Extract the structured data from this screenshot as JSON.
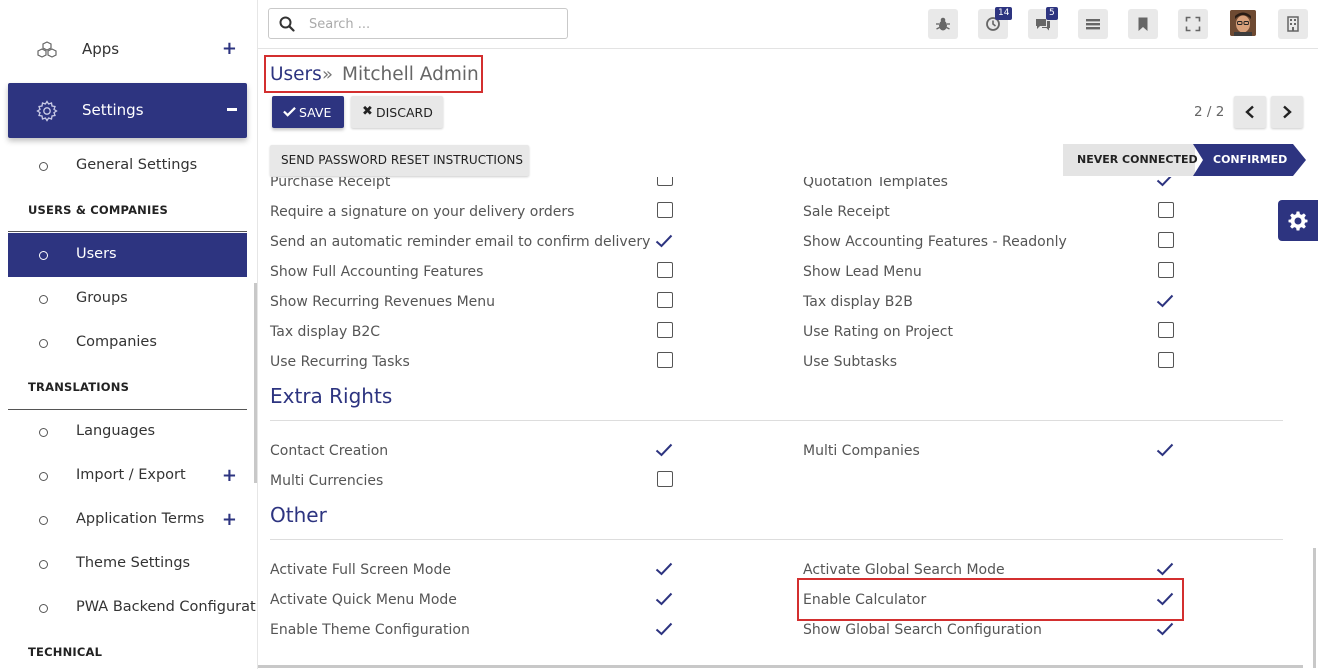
{
  "sidebar": {
    "apps_label": "Apps",
    "settings_label": "Settings",
    "items": [
      {
        "label": "General Settings"
      },
      {
        "label": "Users"
      },
      {
        "label": "Groups"
      },
      {
        "label": "Companies"
      },
      {
        "label": "Languages"
      },
      {
        "label": "Import / Export"
      },
      {
        "label": "Application Terms"
      },
      {
        "label": "Theme Settings"
      },
      {
        "label": "PWA Backend Configurati"
      }
    ],
    "sections": {
      "users_companies": "USERS & COMPANIES",
      "translations": "TRANSLATIONS",
      "technical": "TECHNICAL"
    }
  },
  "topbar": {
    "search_placeholder": "Search ...",
    "activity_badge": "14",
    "messages_badge": "5",
    "icons": [
      "bug-icon",
      "clock-icon",
      "chat-icon",
      "menu-icon",
      "bookmark-icon",
      "fullscreen-icon",
      "avatar",
      "building-icon"
    ]
  },
  "breadcrumb": {
    "parent": "Users",
    "separator": "»",
    "current": "Mitchell Admin"
  },
  "actions": {
    "save": "SAVE",
    "discard": "DISCARD",
    "reset_password": "SEND PASSWORD RESET INSTRUCTIONS"
  },
  "pager": {
    "value": "2 / 2"
  },
  "status": {
    "never_connected": "NEVER CONNECTED",
    "confirmed": "CONFIRMED"
  },
  "rights": {
    "left": [
      {
        "label": "Purchase Receipt",
        "checked": false
      },
      {
        "label": "Require a signature on your delivery orders",
        "checked": false
      },
      {
        "label": "Send an automatic reminder email to confirm delivery",
        "checked": true
      },
      {
        "label": "Show Full Accounting Features",
        "checked": false
      },
      {
        "label": "Show Recurring Revenues Menu",
        "checked": false
      },
      {
        "label": "Tax display B2C",
        "checked": false
      },
      {
        "label": "Use Recurring Tasks",
        "checked": false
      }
    ],
    "right": [
      {
        "label": "Quotation Templates",
        "checked": true
      },
      {
        "label": "Sale Receipt",
        "checked": false
      },
      {
        "label": "Show Accounting Features - Readonly",
        "checked": false
      },
      {
        "label": "Show Lead Menu",
        "checked": false
      },
      {
        "label": "Tax display B2B",
        "checked": true
      },
      {
        "label": "Use Rating on Project",
        "checked": false
      },
      {
        "label": "Use Subtasks",
        "checked": false
      }
    ]
  },
  "extra_rights": {
    "title": "Extra Rights",
    "left": [
      {
        "label": "Contact Creation",
        "checked": true
      },
      {
        "label": "Multi Currencies",
        "checked": false
      }
    ],
    "right": [
      {
        "label": "Multi Companies",
        "checked": true
      }
    ]
  },
  "other": {
    "title": "Other",
    "left": [
      {
        "label": "Activate Full Screen Mode",
        "checked": true
      },
      {
        "label": "Activate Quick Menu Mode",
        "checked": true
      },
      {
        "label": "Enable Theme Configuration",
        "checked": true
      }
    ],
    "right": [
      {
        "label": "Activate Global Search Mode",
        "checked": true
      },
      {
        "label": "Enable Calculator",
        "checked": true
      },
      {
        "label": "Show Global Search Configuration",
        "checked": true
      }
    ]
  },
  "colors": {
    "primary": "#2d3480",
    "highlight": "#d32f2f"
  }
}
